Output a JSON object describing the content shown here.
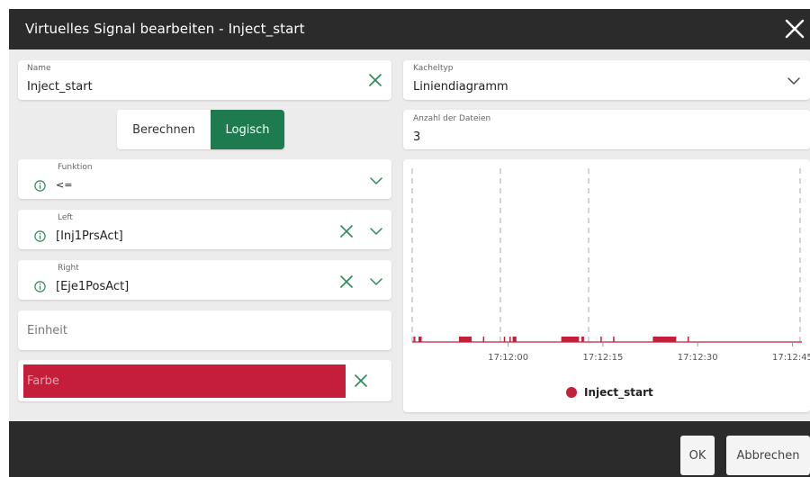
{
  "dialog": {
    "title": "Virtuelles Signal bearbeiten - Inject_start"
  },
  "left": {
    "name": {
      "label": "Name",
      "value": "Inject_start"
    },
    "mode_toggle": {
      "options": [
        "Berechnen",
        "Logisch"
      ],
      "selected": "Logisch"
    },
    "funktion": {
      "label": "Funktion",
      "value": "<="
    },
    "left_operand": {
      "label": "Left",
      "value": "[Inj1PrsAct]"
    },
    "right_operand": {
      "label": "Right",
      "value": "[Eje1PosAct]"
    },
    "einheit": {
      "placeholder": "Einheit"
    },
    "farbe": {
      "placeholder": "Farbe",
      "color": "#c41e3a"
    }
  },
  "right": {
    "kacheltyp": {
      "label": "Kacheltyp",
      "value": "Liniendiagramm"
    },
    "anzahl": {
      "label": "Anzahl der Dateien",
      "value": "3"
    }
  },
  "chart_data": {
    "type": "line",
    "x_ticks": [
      "17:12:00",
      "17:12:15",
      "17:12:30",
      "17:12:45"
    ],
    "series": [
      {
        "name": "Inject_start",
        "color": "#c41e3a",
        "pulses_seconds": [
          [
            -15.0,
            -14.7
          ],
          [
            -14.2,
            -13.7
          ],
          [
            -7.8,
            -5.8
          ],
          [
            -4.0,
            -3.8
          ],
          [
            -0.7,
            -0.5
          ],
          [
            0.2,
            0.4
          ],
          [
            0.7,
            1.3
          ],
          [
            8.4,
            11.2
          ],
          [
            11.6,
            12.0
          ],
          [
            14.6,
            14.8
          ],
          [
            16.6,
            16.8
          ],
          [
            22.9,
            26.6
          ],
          [
            28.4,
            28.6
          ]
        ],
        "x_range": [
          -15.2,
          46.5
        ]
      }
    ],
    "legend_position": "bottom-center"
  },
  "colors": {
    "title_bar": "#2b2b2b",
    "accent_green": "#1e7a4f",
    "icon_green": "#2a8a57",
    "series_red": "#c41e3a"
  },
  "footer": {
    "ok_label": "OK",
    "cancel_label": "Abbrechen"
  },
  "icons": {
    "close": "close-icon",
    "clear": "clear-x-icon",
    "dropdown": "chevron-down-icon",
    "info": "info-icon"
  }
}
